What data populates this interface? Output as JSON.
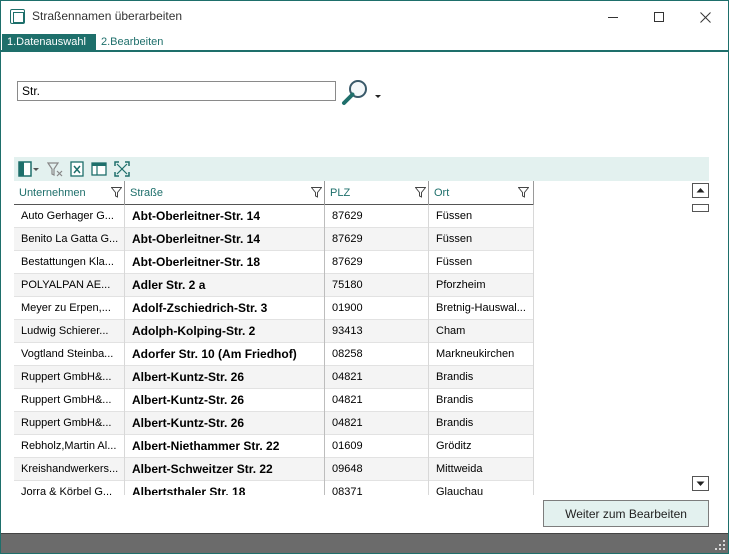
{
  "window": {
    "title": "Straßennamen überarbeiten"
  },
  "tabs": [
    {
      "label": "1.Datenauswahl",
      "active": true
    },
    {
      "label": "2.Bearbeiten",
      "active": false
    }
  ],
  "search": {
    "value": "Str.",
    "icon": "magnifier-icon"
  },
  "toolbar": {
    "icons": [
      "column-chooser-icon",
      "clear-filter-icon",
      "export-excel-icon",
      "layout-icon",
      "fit-columns-icon"
    ]
  },
  "grid": {
    "columns": [
      {
        "label": "Unternehmen"
      },
      {
        "label": "Straße"
      },
      {
        "label": "PLZ"
      },
      {
        "label": "Ort"
      }
    ],
    "rows": [
      {
        "company": "Auto Gerhager G...",
        "street": "Abt-Oberleitner-Str. 14",
        "plz": "87629",
        "ort": "Füssen"
      },
      {
        "company": "Benito La Gatta G...",
        "street": "Abt-Oberleitner-Str. 14",
        "plz": "87629",
        "ort": "Füssen"
      },
      {
        "company": "Bestattungen Kla...",
        "street": "Abt-Oberleitner-Str. 18",
        "plz": "87629",
        "ort": "Füssen"
      },
      {
        "company": "POLYALPAN AE...",
        "street": "Adler Str. 2 a",
        "plz": "75180",
        "ort": "Pforzheim"
      },
      {
        "company": "Meyer zu Erpen,...",
        "street": "Adolf-Zschiedrich-Str. 3",
        "plz": "01900",
        "ort": "Bretnig-Hauswal..."
      },
      {
        "company": "Ludwig Schierer...",
        "street": "Adolph-Kolping-Str. 2",
        "plz": "93413",
        "ort": "Cham"
      },
      {
        "company": "Vogtland Steinba...",
        "street": "Adorfer Str. 10 (Am Friedhof)",
        "plz": "08258",
        "ort": "Markneukirchen"
      },
      {
        "company": "Ruppert GmbH&...",
        "street": "Albert-Kuntz-Str. 26",
        "plz": "04821",
        "ort": "Brandis"
      },
      {
        "company": "Ruppert GmbH&...",
        "street": "Albert-Kuntz-Str. 26",
        "plz": "04821",
        "ort": "Brandis"
      },
      {
        "company": "Ruppert GmbH&...",
        "street": "Albert-Kuntz-Str. 26",
        "plz": "04821",
        "ort": "Brandis"
      },
      {
        "company": "Rebholz,Martin Al...",
        "street": "Albert-Niethammer Str. 22",
        "plz": "01609",
        "ort": "Gröditz"
      },
      {
        "company": "Kreishandwerkers...",
        "street": "Albert-Schweitzer Str. 22",
        "plz": "09648",
        "ort": "Mittweida"
      },
      {
        "company": "Jorra & Körbel G...",
        "street": "Albertsthaler Str. 18",
        "plz": "08371",
        "ort": "Glauchau"
      }
    ]
  },
  "footer": {
    "next_label": "Weiter zum Bearbeiten"
  },
  "colors": {
    "accent": "#1e6f6b",
    "toolbar_bg": "#e3f1ef",
    "status_bar": "#6b6b6b"
  }
}
